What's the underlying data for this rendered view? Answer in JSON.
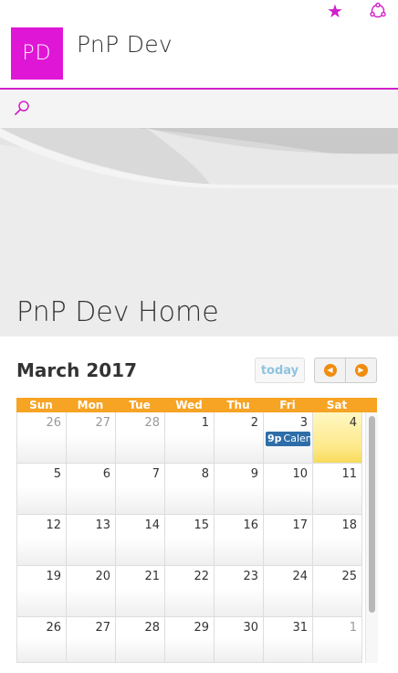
{
  "topbar": {
    "follow_icon": "star-icon",
    "share_icon": "share-icon"
  },
  "site": {
    "logo_text": "PD",
    "title": "PnP Dev",
    "accent_color": "#d11fc9"
  },
  "search": {
    "icon": "search-icon"
  },
  "page": {
    "title": "PnP Dev Home"
  },
  "calendar": {
    "month_label": "March 2017",
    "today_label": "today",
    "prev_icon": "chevron-left-icon",
    "next_icon": "chevron-right-icon",
    "days_of_week": [
      "Sun",
      "Mon",
      "Tue",
      "Wed",
      "Thu",
      "Fri",
      "Sat"
    ],
    "weeks": [
      [
        "26",
        "27",
        "28",
        "1",
        "2",
        "3",
        "4"
      ],
      [
        "5",
        "6",
        "7",
        "8",
        "9",
        "10",
        "11"
      ],
      [
        "12",
        "13",
        "14",
        "15",
        "16",
        "17",
        "18"
      ],
      [
        "19",
        "20",
        "21",
        "22",
        "23",
        "24",
        "25"
      ],
      [
        "26",
        "27",
        "28",
        "29",
        "30",
        "31",
        "1"
      ]
    ],
    "event": {
      "time": "9p",
      "title": "Calen"
    },
    "header_color": "#f7a324",
    "today_color": "#fde98a",
    "event_color": "#2e6ea8"
  }
}
